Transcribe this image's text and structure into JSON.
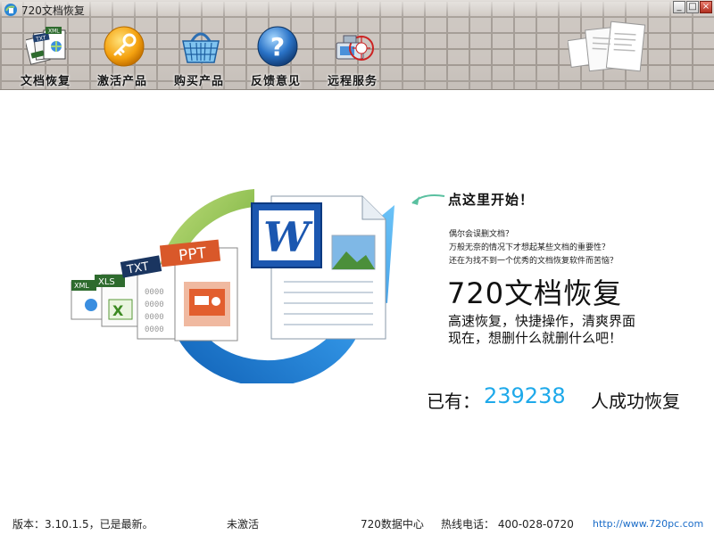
{
  "window": {
    "title": "720文档恢复",
    "buttons": [
      "_",
      "□",
      "×"
    ]
  },
  "toolbar": {
    "items": [
      {
        "label": "文档恢复",
        "icon": "documents-icon"
      },
      {
        "label": "激活产品",
        "icon": "key-icon"
      },
      {
        "label": "购买产品",
        "icon": "basket-icon"
      },
      {
        "label": "反馈意见",
        "icon": "help-icon"
      },
      {
        "label": "远程服务",
        "icon": "remote-service-icon"
      }
    ]
  },
  "hero": {
    "file_types": [
      "XML",
      "XLS",
      "TXT",
      "PPT"
    ],
    "word_letter": "W",
    "cta": "点这里开始！",
    "questions": [
      "偶尔会误删文档？",
      "万般无奈的情况下才想起某些文档的重要性？",
      "还在为找不到一个优秀的文档恢复软件而苦恼？"
    ],
    "brand": "720文档恢复",
    "taglines": [
      "高速恢复，快捷操作，清爽界面",
      "现在，想删什么就删什么吧！"
    ]
  },
  "stats": {
    "prefix": "已有：",
    "count": "239238",
    "suffix": "人成功恢复"
  },
  "status": {
    "version": "版本：3.10.1.5，已是最新。",
    "activation": "未激活",
    "center": "720数据中心",
    "hotline": "热线电话： 400-028-0720",
    "url": "http://www.720pc.com"
  },
  "colors": {
    "accent": "#1ea9ea",
    "link": "#1a6cc8",
    "arrow_blue": "#2a86d6",
    "arrow_green": "#7cb342"
  }
}
